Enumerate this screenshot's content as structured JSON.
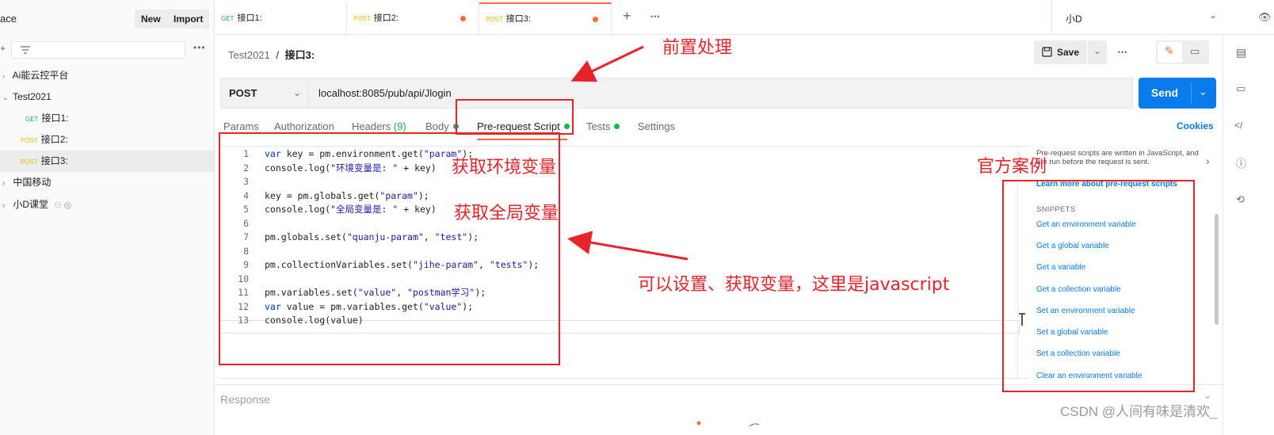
{
  "sidebar": {
    "workspace_title": "ace",
    "new_label": "New",
    "import_label": "Import",
    "items": [
      {
        "label": "Ai能云控平台"
      },
      {
        "label": "Test2021"
      },
      {
        "method": "GET",
        "label": "接口1:"
      },
      {
        "method": "POST",
        "label": "接口2:"
      },
      {
        "method": "POST",
        "label": "接口3:"
      },
      {
        "label": "中国移动"
      },
      {
        "label": "小D课堂"
      }
    ]
  },
  "tabs": [
    {
      "method": "GET",
      "label": "接口1:"
    },
    {
      "method": "POST",
      "label": "接口2:"
    },
    {
      "method": "POST",
      "label": "接口3:"
    }
  ],
  "environment": "小D",
  "breadcrumb": {
    "collection": "Test2021",
    "separator": "/",
    "request": "接口3:"
  },
  "toolbar": {
    "save_label": "Save"
  },
  "request": {
    "method": "POST",
    "url": "localhost:8085/pub/api/Jlogin",
    "send_label": "Send"
  },
  "request_tabs": [
    {
      "label": "Params"
    },
    {
      "label": "Authorization"
    },
    {
      "label": "Headers",
      "count": "(9)"
    },
    {
      "label": "Body"
    },
    {
      "label": "Pre-request Script"
    },
    {
      "label": "Tests"
    },
    {
      "label": "Settings"
    }
  ],
  "cookies_label": "Cookies",
  "editor_lines": [
    "var key = pm.environment.get(\"param\");",
    "console.log(\"环境变量是: \" + key)",
    "",
    "key = pm.globals.get(\"param\");",
    "console.log(\"全局变量是: \" + key)",
    "",
    "pm.globals.set(\"quanju-param\", \"test\");",
    "",
    "pm.collectionVariables.set(\"jihe-param\", \"tests\");",
    "",
    "pm.variables.set(\"value\", \"postman学习\");",
    "var value = pm.variables.get(\"value\");",
    "console.log(value)"
  ],
  "side_panel": {
    "description": "Pre-request scripts are written in JavaScript, and are run before the request is sent.",
    "learn_more": "Learn more about pre-request scripts",
    "snippets_heading": "SNIPPETS",
    "snippets": [
      "Get an environment variable",
      "Get a global variable",
      "Get a variable",
      "Get a collection variable",
      "Set an environment variable",
      "Set a global variable",
      "Set a collection variable",
      "Clear an environment variable"
    ]
  },
  "response_label": "Response",
  "annotations": {
    "preprocess": "前置处理",
    "get_env": "获取环境变量",
    "get_global": "获取全局变量",
    "official": "官方案例",
    "set_get": "可以设置、获取变量，这里是javascript"
  },
  "watermark": "CSDN @人间有味是清欢_",
  "colors": {
    "accent": "#ff6c37",
    "send": "#097bed",
    "get": "#0cbb52",
    "post": "#ffb400",
    "annotation": "#e8232a"
  }
}
